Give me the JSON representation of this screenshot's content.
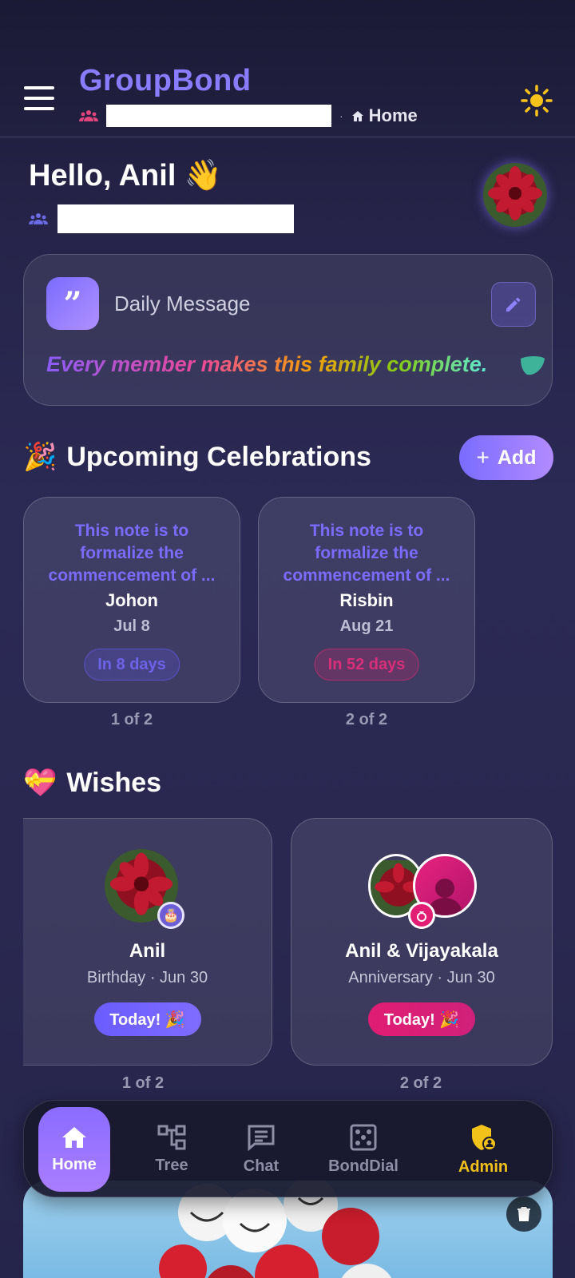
{
  "header": {
    "brand": "GroupBond",
    "breadcrumb_separator": "·",
    "breadcrumb_page": "Home",
    "theme_icon": "sun-icon"
  },
  "greeting": {
    "hello": "Hello, Anil 👋"
  },
  "daily": {
    "title": "Daily Message",
    "quote_glyph": "”",
    "message": "Every member makes this family complete."
  },
  "celebrations": {
    "title": "Upcoming Celebrations",
    "emoji": "🎉",
    "add_label": "Add",
    "add_plus": "+",
    "items": [
      {
        "note": "This note is to formalize the commencement of ...",
        "name": "Johon",
        "date": "Jul 8",
        "countdown": "In 8 days",
        "pager": "1 of 2"
      },
      {
        "note": "This note is to formalize the commencement of ...",
        "name": "Risbin",
        "date": "Aug 21",
        "countdown": "In 52 days",
        "pager": "2 of 2"
      }
    ]
  },
  "wishes": {
    "title": "Wishes",
    "emoji": "💝",
    "items": [
      {
        "name": "Anil",
        "subtitle": "Birthday · Jun 30",
        "badge": "Today! 🎉",
        "pager": "1 of 2",
        "badge_color": "#6a5cff"
      },
      {
        "name": "Anil & Vijayakala",
        "subtitle": "Anniversary · Jun 30",
        "badge": "Today! 🎉",
        "pager": "2 of 2",
        "badge_color": "#e11d74"
      }
    ]
  },
  "nav": {
    "home": "Home",
    "tree": "Tree",
    "chat": "Chat",
    "bonddial": "BondDial",
    "admin": "Admin"
  },
  "colors": {
    "accent": "#7a6cff",
    "admin": "#f2c21a",
    "pink": "#e11d74"
  }
}
